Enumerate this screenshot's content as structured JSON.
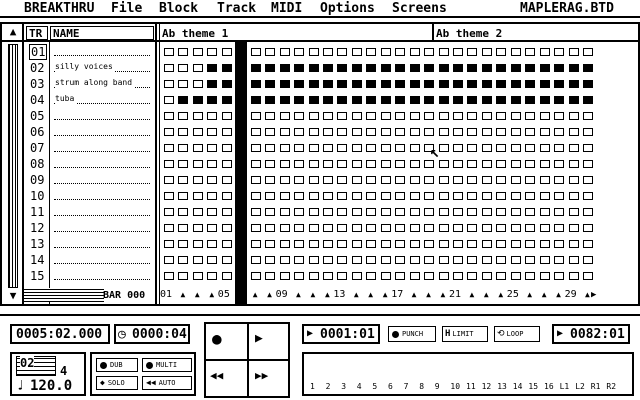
{
  "menu": {
    "app": "BREAKTHRU",
    "items": [
      "File",
      "Block",
      "Track",
      "MIDI",
      "Options",
      "Screens"
    ],
    "filename": "MAPLERAG.BTD"
  },
  "grid": {
    "col_tr": "TR",
    "col_name": "NAME",
    "block1": "Ab theme 1",
    "block2": "Ab theme 2",
    "bar_label": "BAR",
    "bar_value": "000",
    "bar_numbers": [
      "01",
      "05",
      "09",
      "13",
      "17",
      "21",
      "25",
      "29"
    ],
    "tracks": [
      {
        "num": "01",
        "name": ""
      },
      {
        "num": "02",
        "name": "silly voices"
      },
      {
        "num": "03",
        "name": "strum along band"
      },
      {
        "num": "04",
        "name": "tuba"
      },
      {
        "num": "05",
        "name": ""
      },
      {
        "num": "06",
        "name": ""
      },
      {
        "num": "07",
        "name": ""
      },
      {
        "num": "08",
        "name": ""
      },
      {
        "num": "09",
        "name": ""
      },
      {
        "num": "10",
        "name": ""
      },
      {
        "num": "11",
        "name": ""
      },
      {
        "num": "12",
        "name": ""
      },
      {
        "num": "13",
        "name": ""
      },
      {
        "num": "14",
        "name": ""
      },
      {
        "num": "15",
        "name": ""
      }
    ],
    "filled": [
      [],
      [
        3,
        4,
        5,
        6,
        7,
        8,
        9,
        10,
        11,
        12,
        13,
        14,
        15,
        16,
        17,
        18,
        19,
        20,
        21,
        22,
        23,
        24,
        25,
        26,
        27,
        28,
        29
      ],
      [
        3,
        4,
        5,
        6,
        7,
        8,
        9,
        10,
        11,
        12,
        13,
        14,
        15,
        16,
        17,
        18,
        19,
        20,
        21,
        22,
        23,
        24,
        25,
        26,
        27,
        28,
        29
      ],
      [
        1,
        2,
        3,
        4,
        5,
        6,
        7,
        8,
        9,
        10,
        11,
        12,
        13,
        14,
        15,
        16,
        17,
        18,
        19,
        20,
        21,
        22,
        23,
        24,
        25,
        26,
        27,
        28,
        29
      ],
      [],
      [],
      [],
      [],
      [],
      [],
      [],
      [],
      [],
      [],
      []
    ],
    "playhead_bar": 5,
    "bars_total": 30
  },
  "transport": {
    "position": "0005:02.000",
    "clock": "0000:04",
    "punch_start": "0001:01",
    "punch_label": "PUNCH",
    "limit_label": "LIMIT",
    "loop_label": "LOOP",
    "punch_end": "0082:01",
    "time_sig_top": "02",
    "time_sig_bottom": "4",
    "tempo": "120.0",
    "dub_label": "DUB",
    "multi_label": "MULTI",
    "solo_label": "SOLO",
    "auto_label": "AUTO",
    "channels": [
      "1",
      "2",
      "3",
      "4",
      "5",
      "6",
      "7",
      "8",
      "9",
      "10",
      "11",
      "12",
      "13",
      "14",
      "15",
      "16",
      "L1",
      "L2",
      "R1",
      "R2"
    ]
  }
}
